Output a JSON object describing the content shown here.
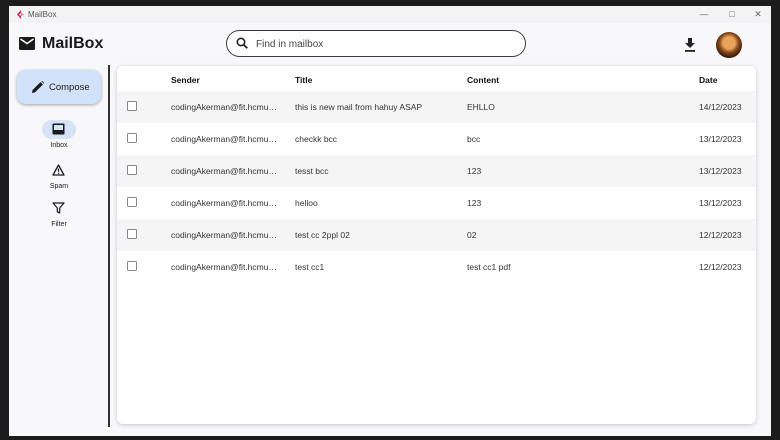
{
  "window": {
    "title": "MailBox"
  },
  "header": {
    "app_name": "MailBox",
    "search": {
      "placeholder": "Find in mailbox",
      "value": ""
    }
  },
  "sidebar": {
    "compose_label": "Compose",
    "items": [
      {
        "label": "Inbox",
        "icon": "inbox-icon",
        "active": true
      },
      {
        "label": "Spam",
        "icon": "warning-icon",
        "active": false
      },
      {
        "label": "Filter",
        "icon": "filter-icon",
        "active": false
      }
    ]
  },
  "table": {
    "columns": [
      "Sender",
      "Title",
      "Content",
      "Date"
    ],
    "rows": [
      {
        "sender": "codingAkerman@fit.hcmu…",
        "title": "this is new mail from hahuy ASAP",
        "content": "EHLLO",
        "date": "14/12/2023"
      },
      {
        "sender": "codingAkerman@fit.hcmu…",
        "title": "checkk bcc",
        "content": "bcc",
        "date": "13/12/2023"
      },
      {
        "sender": "codingAkerman@fit.hcmu…",
        "title": "tesst bcc",
        "content": "123",
        "date": "13/12/2023"
      },
      {
        "sender": "codingAkerman@fit.hcmu…",
        "title": "helloo",
        "content": "123",
        "date": "13/12/2023"
      },
      {
        "sender": "codingAkerman@fit.hcmu…",
        "title": "test cc 2ppl 02",
        "content": "02",
        "date": "12/12/2023"
      },
      {
        "sender": "codingAkerman@fit.hcmu…",
        "title": "test cc1",
        "content": "test cc1 pdf",
        "date": "12/12/2023"
      }
    ]
  },
  "colors": {
    "compose_bg": "#d3e2fb",
    "active_nav_bg": "#d6e3f7",
    "row_alt_bg": "#f5f5f5",
    "app_icon_accent": "#d3245c"
  }
}
